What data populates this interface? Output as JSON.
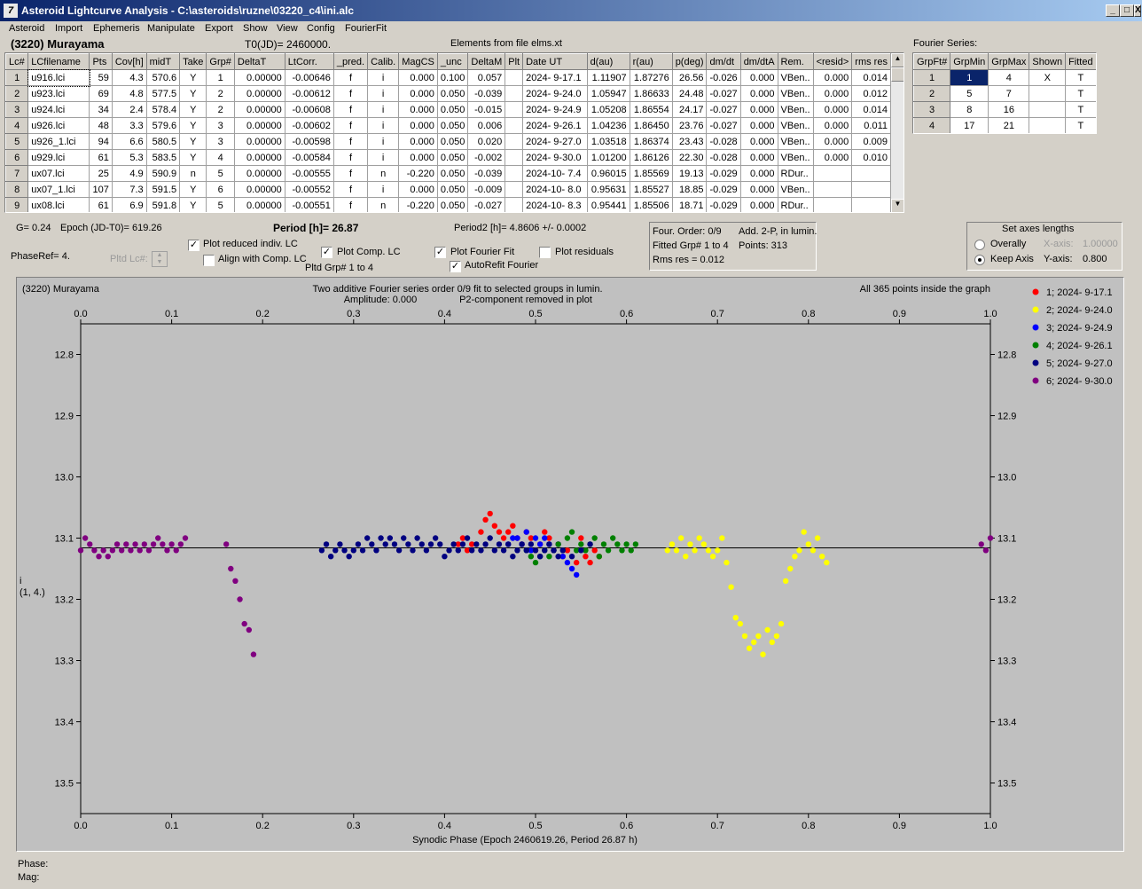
{
  "window": {
    "title": "Asteroid Lightcurve Analysis - C:\\asteroids\\ruzne\\03220_c4\\ini.alc",
    "app_icon": "7",
    "controls": [
      "_",
      "□",
      "X"
    ]
  },
  "menu": [
    "Asteroid",
    "Import",
    "Ephemeris",
    "Manipulate",
    "Export",
    "Show",
    "View",
    "Config",
    "FourierFit"
  ],
  "header": {
    "asteroid": "(3220) Murayama",
    "t0": "T0(JD)= 2460000.",
    "elements": "Elements from file elms.xt",
    "fourier_series_label": "Fourier Series:"
  },
  "lc_table": {
    "columns": [
      "Lc#",
      "LCfilename",
      "Pts",
      "Cov[h]",
      "midT",
      "Take",
      "Grp#",
      "DeltaT",
      "LtCorr.",
      "_pred.",
      "Calib.",
      "MagCS",
      "_unc",
      "DeltaM",
      "Plt",
      "Date UT",
      "d(au)",
      "r(au)",
      "p(deg)",
      "dm/dt",
      "dm/dtA",
      "Rem.",
      "<resid>",
      "rms res"
    ],
    "rows": [
      [
        "1",
        "u916.lci",
        "59",
        "4.3",
        "570.6",
        "Y",
        "1",
        "0.00000",
        "-0.00646",
        "f",
        "i",
        "0.000",
        "0.100",
        "0.057",
        "",
        "2024- 9-17.1",
        "1.11907",
        "1.87276",
        "26.56",
        "-0.026",
        "0.000",
        "VBen..",
        "0.000",
        "0.014"
      ],
      [
        "2",
        "u923.lci",
        "69",
        "4.8",
        "577.5",
        "Y",
        "2",
        "0.00000",
        "-0.00612",
        "f",
        "i",
        "0.000",
        "0.050",
        "-0.039",
        "",
        "2024- 9-24.0",
        "1.05947",
        "1.86633",
        "24.48",
        "-0.027",
        "0.000",
        "VBen..",
        "0.000",
        "0.012"
      ],
      [
        "3",
        "u924.lci",
        "34",
        "2.4",
        "578.4",
        "Y",
        "2",
        "0.00000",
        "-0.00608",
        "f",
        "i",
        "0.000",
        "0.050",
        "-0.015",
        "",
        "2024- 9-24.9",
        "1.05208",
        "1.86554",
        "24.17",
        "-0.027",
        "0.000",
        "VBen..",
        "0.000",
        "0.014"
      ],
      [
        "4",
        "u926.lci",
        "48",
        "3.3",
        "579.6",
        "Y",
        "3",
        "0.00000",
        "-0.00602",
        "f",
        "i",
        "0.000",
        "0.050",
        "0.006",
        "",
        "2024- 9-26.1",
        "1.04236",
        "1.86450",
        "23.76",
        "-0.027",
        "0.000",
        "VBen..",
        "0.000",
        "0.011"
      ],
      [
        "5",
        "u926_1.lci",
        "94",
        "6.6",
        "580.5",
        "Y",
        "3",
        "0.00000",
        "-0.00598",
        "f",
        "i",
        "0.000",
        "0.050",
        "0.020",
        "",
        "2024- 9-27.0",
        "1.03518",
        "1.86374",
        "23.43",
        "-0.028",
        "0.000",
        "VBen..",
        "0.000",
        "0.009"
      ],
      [
        "6",
        "u929.lci",
        "61",
        "5.3",
        "583.5",
        "Y",
        "4",
        "0.00000",
        "-0.00584",
        "f",
        "i",
        "0.000",
        "0.050",
        "-0.002",
        "",
        "2024- 9-30.0",
        "1.01200",
        "1.86126",
        "22.30",
        "-0.028",
        "0.000",
        "VBen..",
        "0.000",
        "0.010"
      ],
      [
        "7",
        "ux07.lci",
        "25",
        "4.9",
        "590.9",
        "n",
        "5",
        "0.00000",
        "-0.00555",
        "f",
        "n",
        "-0.220",
        "0.050",
        "-0.039",
        "",
        "2024-10- 7.4",
        "0.96015",
        "1.85569",
        "19.13",
        "-0.029",
        "0.000",
        "RDur..",
        "",
        ""
      ],
      [
        "8",
        "ux07_1.lci",
        "107",
        "7.3",
        "591.5",
        "Y",
        "6",
        "0.00000",
        "-0.00552",
        "f",
        "i",
        "0.000",
        "0.050",
        "-0.009",
        "",
        "2024-10- 8.0",
        "0.95631",
        "1.85527",
        "18.85",
        "-0.029",
        "0.000",
        "VBen..",
        "",
        ""
      ],
      [
        "9",
        "ux08.lci",
        "61",
        "6.9",
        "591.8",
        "Y",
        "5",
        "0.00000",
        "-0.00551",
        "f",
        "n",
        "-0.220",
        "0.050",
        "-0.027",
        "",
        "2024-10- 8.3",
        "0.95441",
        "1.85506",
        "18.71",
        "-0.029",
        "0.000",
        "RDur..",
        "",
        ""
      ]
    ]
  },
  "fourier_table": {
    "columns": [
      "GrpFt#",
      "GrpMin",
      "GrpMax",
      "Shown",
      "Fitted"
    ],
    "rows": [
      [
        "1",
        "1",
        "4",
        "X",
        "T"
      ],
      [
        "2",
        "5",
        "7",
        "",
        "T"
      ],
      [
        "3",
        "8",
        "16",
        "",
        "T"
      ],
      [
        "4",
        "17",
        "21",
        "",
        "T"
      ]
    ]
  },
  "controls": {
    "g": "G= 0.24",
    "epoch": "Epoch (JD-T0)= 619.26",
    "period": "Period [h]= 26.87",
    "period2": "Period2 [h]= 4.8606 +/- 0.0002",
    "phaseref": "PhaseRef= 4.",
    "pltd_lc": "Pltd Lc#:",
    "plot_reduced": "Plot reduced indiv. LC",
    "align_comp": "Align with Comp. LC",
    "plot_comp": "Plot Comp. LC",
    "pltd_grp": "Pltd Grp#  1   to   4",
    "plot_fourier": "Plot Fourier Fit",
    "autorefit": "AutoRefit Fourier",
    "plot_residuals": "Plot residuals",
    "check_plot_reduced": "✓",
    "check_align_comp": "",
    "check_plot_comp": "✓",
    "check_plot_fourier": "✓",
    "check_autorefit": "✓",
    "check_plot_residuals": ""
  },
  "fit_info": {
    "order": "Four. Order:  0/9",
    "add": "Add. 2-P, in lumin.",
    "fitted": "Fitted Grp# 1 to 4",
    "points": "Points: 313",
    "rms": "Rms res      = 0.012"
  },
  "axes_box": {
    "title": "Set axes lengths",
    "overally": "Overally",
    "keep_axis": "Keep Axis",
    "xaxis_label": "X-axis:",
    "xaxis_value": "1.00000",
    "yaxis_label": "Y-axis:",
    "yaxis_value": "0.800"
  },
  "footer": {
    "phase": "Phase:",
    "mag": "Mag:"
  },
  "chart_data": {
    "type": "scatter",
    "title_left": "(3220) Murayama",
    "title": "Two additive Fourier series order 0/9 fit to selected groups in lumin.",
    "subtitle_amp": "Amplitude: 0.000",
    "subtitle_p2": "P2-component removed in plot",
    "note_right": "All 365 points inside the graph",
    "xlabel": "Synodic Phase (Epoch 2460619.26, Period 26.87 h)",
    "ylabel": "i",
    "ylabel2": "(1, 4.)",
    "xlim": [
      0,
      1
    ],
    "ylim": [
      12.8,
      13.5
    ],
    "y_inverted": true,
    "x_ticks": [
      "0.0",
      "0.1",
      "0.2",
      "0.3",
      "0.4",
      "0.5",
      "0.6",
      "0.7",
      "0.8",
      "0.9",
      "1.0"
    ],
    "y_ticks": [
      "12.8",
      "12.9",
      "13.0",
      "13.1",
      "13.2",
      "13.3",
      "13.4",
      "13.5"
    ],
    "fit_line_y": 13.116,
    "legend_position": "top-right",
    "series": [
      {
        "name": "1; 2024- 9-17.1",
        "color": "#ff0000",
        "points": [
          [
            0.415,
            13.11
          ],
          [
            0.42,
            13.1
          ],
          [
            0.425,
            13.12
          ],
          [
            0.43,
            13.11
          ],
          [
            0.44,
            13.09
          ],
          [
            0.445,
            13.07
          ],
          [
            0.45,
            13.06
          ],
          [
            0.455,
            13.08
          ],
          [
            0.46,
            13.09
          ],
          [
            0.465,
            13.1
          ],
          [
            0.47,
            13.09
          ],
          [
            0.475,
            13.08
          ],
          [
            0.48,
            13.1
          ],
          [
            0.485,
            13.11
          ],
          [
            0.49,
            13.09
          ],
          [
            0.495,
            13.1
          ],
          [
            0.5,
            13.12
          ],
          [
            0.505,
            13.11
          ],
          [
            0.51,
            13.09
          ],
          [
            0.515,
            13.1
          ],
          [
            0.52,
            13.12
          ],
          [
            0.525,
            13.11
          ],
          [
            0.53,
            13.13
          ],
          [
            0.535,
            13.12
          ],
          [
            0.545,
            13.14
          ],
          [
            0.55,
            13.1
          ],
          [
            0.555,
            13.13
          ],
          [
            0.56,
            13.14
          ],
          [
            0.565,
            13.12
          ],
          [
            0.57,
            13.13
          ]
        ]
      },
      {
        "name": "2; 2024- 9-24.0",
        "color": "#ffff00",
        "points": [
          [
            0.645,
            13.12
          ],
          [
            0.65,
            13.11
          ],
          [
            0.655,
            13.12
          ],
          [
            0.66,
            13.1
          ],
          [
            0.665,
            13.13
          ],
          [
            0.67,
            13.11
          ],
          [
            0.675,
            13.12
          ],
          [
            0.68,
            13.1
          ],
          [
            0.685,
            13.11
          ],
          [
            0.69,
            13.12
          ],
          [
            0.695,
            13.13
          ],
          [
            0.7,
            13.12
          ],
          [
            0.705,
            13.1
          ],
          [
            0.71,
            13.14
          ],
          [
            0.715,
            13.18
          ],
          [
            0.72,
            13.23
          ],
          [
            0.725,
            13.24
          ],
          [
            0.73,
            13.26
          ],
          [
            0.735,
            13.28
          ],
          [
            0.74,
            13.27
          ],
          [
            0.745,
            13.26
          ],
          [
            0.75,
            13.29
          ],
          [
            0.755,
            13.25
          ],
          [
            0.76,
            13.27
          ],
          [
            0.765,
            13.26
          ],
          [
            0.77,
            13.24
          ],
          [
            0.775,
            13.17
          ],
          [
            0.78,
            13.15
          ],
          [
            0.785,
            13.13
          ],
          [
            0.79,
            13.12
          ],
          [
            0.795,
            13.09
          ],
          [
            0.8,
            13.11
          ],
          [
            0.805,
            13.12
          ],
          [
            0.81,
            13.1
          ],
          [
            0.815,
            13.13
          ],
          [
            0.82,
            13.14
          ]
        ]
      },
      {
        "name": "3; 2024- 9-24.9",
        "color": "#0000ff",
        "points": [
          [
            0.47,
            13.11
          ],
          [
            0.475,
            13.1
          ],
          [
            0.48,
            13.1
          ],
          [
            0.485,
            13.11
          ],
          [
            0.49,
            13.09
          ],
          [
            0.495,
            13.12
          ],
          [
            0.5,
            13.1
          ],
          [
            0.505,
            13.11
          ],
          [
            0.51,
            13.1
          ],
          [
            0.515,
            13.11
          ],
          [
            0.52,
            13.12
          ],
          [
            0.525,
            13.11
          ],
          [
            0.53,
            13.13
          ],
          [
            0.535,
            13.14
          ],
          [
            0.54,
            13.15
          ],
          [
            0.545,
            13.16
          ]
        ]
      },
      {
        "name": "4; 2024- 9-26.1",
        "color": "#008000",
        "points": [
          [
            0.49,
            13.12
          ],
          [
            0.495,
            13.13
          ],
          [
            0.5,
            13.14
          ],
          [
            0.505,
            13.13
          ],
          [
            0.51,
            13.12
          ],
          [
            0.515,
            13.13
          ],
          [
            0.52,
            13.12
          ],
          [
            0.525,
            13.11
          ],
          [
            0.53,
            13.12
          ],
          [
            0.535,
            13.1
          ],
          [
            0.54,
            13.09
          ],
          [
            0.545,
            13.12
          ],
          [
            0.55,
            13.11
          ],
          [
            0.555,
            13.12
          ],
          [
            0.56,
            13.11
          ],
          [
            0.565,
            13.1
          ],
          [
            0.57,
            13.13
          ],
          [
            0.575,
            13.11
          ],
          [
            0.58,
            13.12
          ],
          [
            0.585,
            13.1
          ],
          [
            0.59,
            13.11
          ],
          [
            0.595,
            13.12
          ],
          [
            0.6,
            13.11
          ],
          [
            0.605,
            13.12
          ],
          [
            0.61,
            13.11
          ]
        ]
      },
      {
        "name": "5; 2024- 9-27.0",
        "color": "#000080",
        "points": [
          [
            0.265,
            13.12
          ],
          [
            0.27,
            13.11
          ],
          [
            0.275,
            13.13
          ],
          [
            0.28,
            13.12
          ],
          [
            0.285,
            13.11
          ],
          [
            0.29,
            13.12
          ],
          [
            0.295,
            13.13
          ],
          [
            0.3,
            13.12
          ],
          [
            0.305,
            13.11
          ],
          [
            0.31,
            13.12
          ],
          [
            0.315,
            13.1
          ],
          [
            0.32,
            13.11
          ],
          [
            0.325,
            13.12
          ],
          [
            0.33,
            13.1
          ],
          [
            0.335,
            13.11
          ],
          [
            0.34,
            13.1
          ],
          [
            0.345,
            13.11
          ],
          [
            0.35,
            13.12
          ],
          [
            0.355,
            13.1
          ],
          [
            0.36,
            13.11
          ],
          [
            0.365,
            13.12
          ],
          [
            0.37,
            13.1
          ],
          [
            0.375,
            13.11
          ],
          [
            0.38,
            13.12
          ],
          [
            0.385,
            13.11
          ],
          [
            0.39,
            13.1
          ],
          [
            0.395,
            13.11
          ],
          [
            0.4,
            13.13
          ],
          [
            0.405,
            13.12
          ],
          [
            0.41,
            13.11
          ],
          [
            0.415,
            13.12
          ],
          [
            0.42,
            13.11
          ],
          [
            0.425,
            13.1
          ],
          [
            0.43,
            13.12
          ],
          [
            0.435,
            13.11
          ],
          [
            0.44,
            13.12
          ],
          [
            0.445,
            13.11
          ],
          [
            0.45,
            13.1
          ],
          [
            0.455,
            13.12
          ],
          [
            0.46,
            13.11
          ],
          [
            0.465,
            13.12
          ],
          [
            0.47,
            13.11
          ],
          [
            0.475,
            13.13
          ],
          [
            0.48,
            13.12
          ],
          [
            0.485,
            13.11
          ],
          [
            0.49,
            13.12
          ],
          [
            0.495,
            13.11
          ],
          [
            0.5,
            13.12
          ],
          [
            0.505,
            13.13
          ],
          [
            0.51,
            13.12
          ],
          [
            0.515,
            13.11
          ],
          [
            0.52,
            13.12
          ],
          [
            0.525,
            13.13
          ],
          [
            0.53,
            13.12
          ],
          [
            0.54,
            13.13
          ],
          [
            0.55,
            13.12
          ],
          [
            0.56,
            13.11
          ]
        ]
      },
      {
        "name": "6; 2024- 9-30.0",
        "color": "#800080",
        "points": [
          [
            0.0,
            13.12
          ],
          [
            0.005,
            13.1
          ],
          [
            0.01,
            13.11
          ],
          [
            0.015,
            13.12
          ],
          [
            0.02,
            13.13
          ],
          [
            0.025,
            13.12
          ],
          [
            0.03,
            13.13
          ],
          [
            0.035,
            13.12
          ],
          [
            0.04,
            13.11
          ],
          [
            0.045,
            13.12
          ],
          [
            0.05,
            13.11
          ],
          [
            0.055,
            13.12
          ],
          [
            0.06,
            13.11
          ],
          [
            0.065,
            13.12
          ],
          [
            0.07,
            13.11
          ],
          [
            0.075,
            13.12
          ],
          [
            0.08,
            13.11
          ],
          [
            0.085,
            13.1
          ],
          [
            0.09,
            13.11
          ],
          [
            0.095,
            13.12
          ],
          [
            0.1,
            13.11
          ],
          [
            0.105,
            13.12
          ],
          [
            0.11,
            13.11
          ],
          [
            0.115,
            13.1
          ],
          [
            0.16,
            13.11
          ],
          [
            0.165,
            13.15
          ],
          [
            0.17,
            13.17
          ],
          [
            0.175,
            13.2
          ],
          [
            0.18,
            13.24
          ],
          [
            0.185,
            13.25
          ],
          [
            0.19,
            13.29
          ],
          [
            1.0,
            13.1
          ],
          [
            0.995,
            13.12
          ],
          [
            0.99,
            13.11
          ]
        ]
      }
    ]
  }
}
